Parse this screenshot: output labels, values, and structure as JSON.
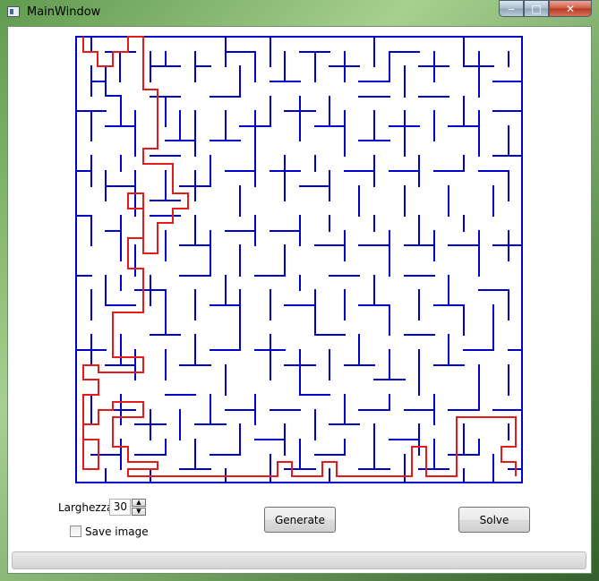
{
  "window": {
    "title": "MainWindow",
    "controls": {
      "minimize": "‒",
      "maximize": "□",
      "close": "✕"
    }
  },
  "colors": {
    "maze_wall": "#0000cc",
    "solution_path": "#e31b1b"
  },
  "controls": {
    "width_label": "Larghezza",
    "width_value": "30",
    "save_image_label": "Save image",
    "save_image_checked": false,
    "generate_label": "Generate",
    "solve_label": "Solve",
    "progress": 0
  }
}
